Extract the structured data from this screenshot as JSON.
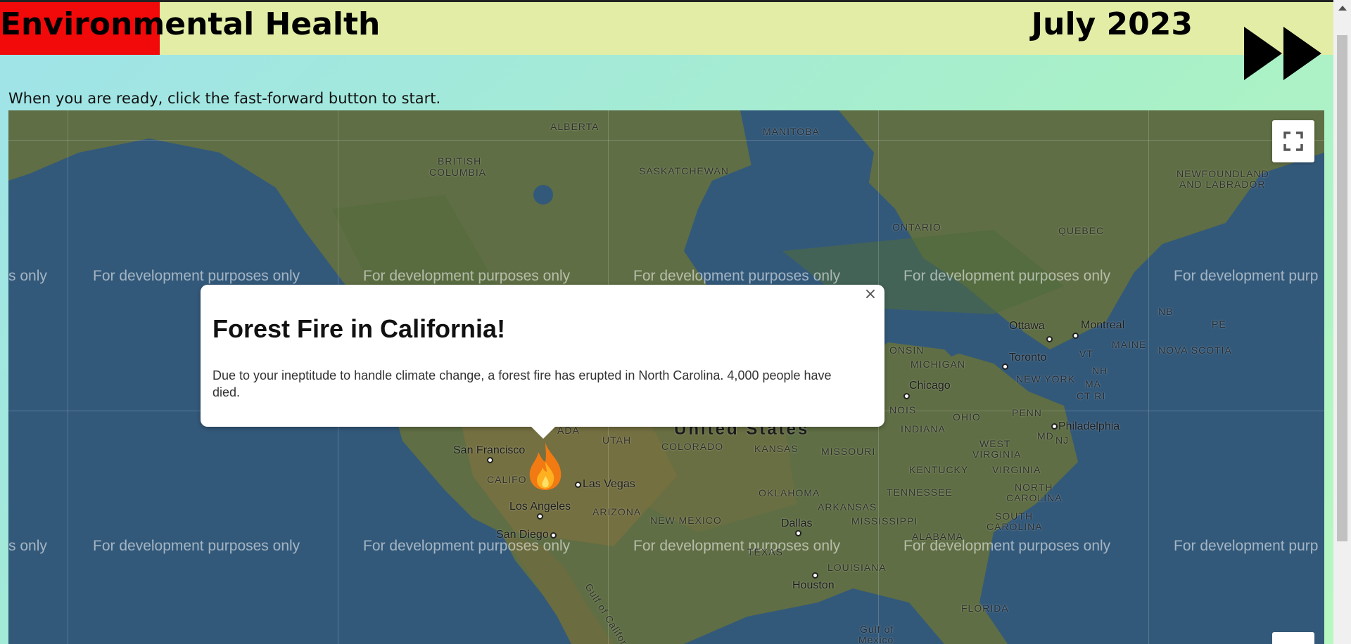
{
  "header": {
    "title": "Environmental Health",
    "date": "July 2023",
    "health_level_pct": 12
  },
  "instructions": "When you are ready, click the fast-forward button to start.",
  "icons": {
    "fast_forward": "fast-forward-icon",
    "fullscreen": "fullscreen-icon",
    "close": "close-icon",
    "fire": "fire-icon"
  },
  "map": {
    "watermark": "For development purposes only",
    "watermark_partial_left": "s only",
    "watermark_partial_right": "For development purp",
    "regions": {
      "alberta": "ALBERTA",
      "manitoba": "MANITOBA",
      "british_columbia_1": "BRITISH",
      "british_columbia_2": "COLUMBIA",
      "saskatchewan": "SASKATCHEWAN",
      "ontario": "ONTARIO",
      "quebec": "QUEBEC",
      "newfoundland_1": "NEWFOUNDLAND",
      "newfoundland_2": "AND LABRADOR",
      "nb": "NB",
      "pe": "PE",
      "nova_scotia": "NOVA SCOTIA",
      "maine": "MAINE",
      "vt": "VT",
      "nh": "NH",
      "ma": "MA",
      "ct_ri": "CT RI",
      "new_york": "NEW YORK",
      "michigan": "MICHIGAN",
      "wisconsin_partial": "ONSIN",
      "illinois_partial": "NOIS",
      "indiana": "INDIANA",
      "ohio": "OHIO",
      "penn": "PENN",
      "md": "MD",
      "nj": "NJ",
      "west_virginia_1": "WEST",
      "west_virginia_2": "VIRGINIA",
      "virginia": "VIRGINIA",
      "kentucky": "KENTUCKY",
      "tennessee": "TENNESSEE",
      "north_carolina_1": "NORTH",
      "north_carolina_2": "CAROLINA",
      "south_carolina_1": "SOUTH",
      "south_carolina_2": "CAROLINA",
      "alabama": "ALABAMA",
      "mississippi": "MISSISSIPPI",
      "arkansas": "ARKANSAS",
      "louisiana": "LOUISIANA",
      "florida": "FLORIDA",
      "oklahoma": "OKLAHOMA",
      "texas": "TEXAS",
      "new_mexico": "NEW MEXICO",
      "arizona": "ARIZONA",
      "utah": "UTAH",
      "colorado": "COLORADO",
      "kansas": "KANSAS",
      "missouri": "MISSOURI",
      "nevada_partial": "ADA",
      "california_partial": "CALIFO",
      "gulf_mexico_1": "Gulf of",
      "gulf_mexico_2": "Mexico",
      "gulf_california": "Gulf of California"
    },
    "country": "United States",
    "cities": {
      "ottawa": "Ottawa",
      "montreal": "Montreal",
      "toronto": "Toronto",
      "chicago": "Chicago",
      "philadelphia": "Philadelphia",
      "san_francisco": "San Francisco",
      "las_vegas": "Las Vegas",
      "los_angeles": "Los Angeles",
      "san_diego": "San Diego",
      "dallas": "Dallas",
      "houston": "Houston"
    }
  },
  "popup": {
    "title": "Forest Fire in California!",
    "body": "Due to your ineptitude to handle climate change, a forest fire has erupted in North Carolina. 4,000 people have died.",
    "close_label": "×"
  },
  "colors": {
    "header_bg": "#e3eda6",
    "health_bar": "#f20a0a",
    "water": "#33597a",
    "land": "#5f6e44"
  }
}
